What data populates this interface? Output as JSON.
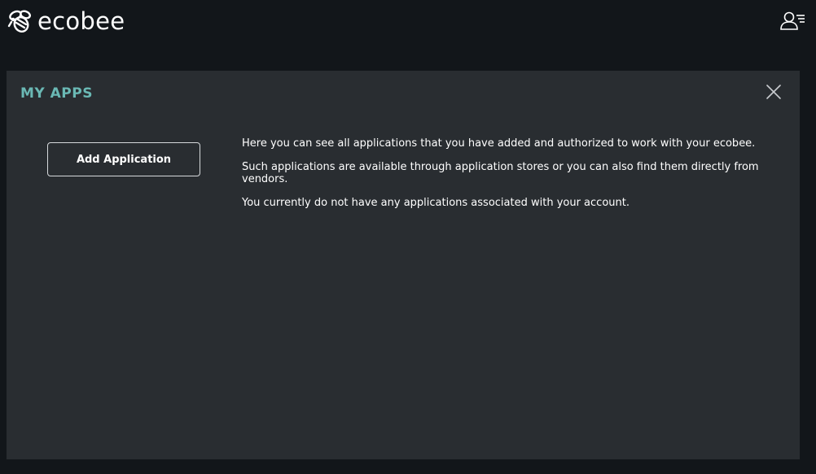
{
  "header": {
    "brand": "ecobee",
    "logo_icon": "bee-icon",
    "user_icon": "user-menu-icon"
  },
  "panel": {
    "title": "MY APPS",
    "close_icon": "close-icon",
    "add_button_label": "Add Application",
    "paragraphs": [
      "Here you can see all applications that you have added and authorized to work with your ecobee.",
      "Such applications are available through application stores or you can also find them directly from vendors.",
      "You currently do not have any applications associated with your account."
    ]
  },
  "colors": {
    "background": "#12161a",
    "panel": "#292d31",
    "accent": "#6ab8b4",
    "text": "#ffffff"
  }
}
